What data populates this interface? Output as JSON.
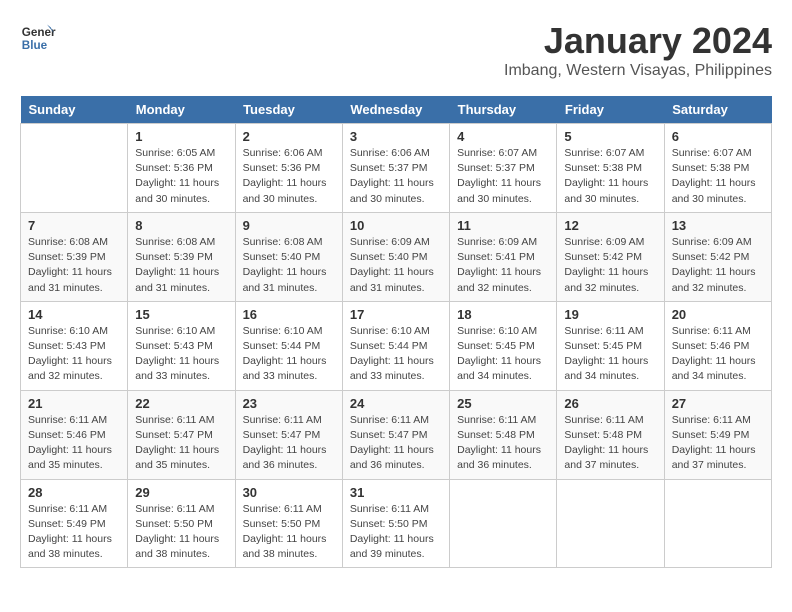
{
  "header": {
    "logo_line1": "General",
    "logo_line2": "Blue",
    "month": "January 2024",
    "location": "Imbang, Western Visayas, Philippines"
  },
  "weekdays": [
    "Sunday",
    "Monday",
    "Tuesday",
    "Wednesday",
    "Thursday",
    "Friday",
    "Saturday"
  ],
  "weeks": [
    [
      {
        "day": "",
        "info": ""
      },
      {
        "day": "1",
        "info": "Sunrise: 6:05 AM\nSunset: 5:36 PM\nDaylight: 11 hours and 30 minutes."
      },
      {
        "day": "2",
        "info": "Sunrise: 6:06 AM\nSunset: 5:36 PM\nDaylight: 11 hours and 30 minutes."
      },
      {
        "day": "3",
        "info": "Sunrise: 6:06 AM\nSunset: 5:37 PM\nDaylight: 11 hours and 30 minutes."
      },
      {
        "day": "4",
        "info": "Sunrise: 6:07 AM\nSunset: 5:37 PM\nDaylight: 11 hours and 30 minutes."
      },
      {
        "day": "5",
        "info": "Sunrise: 6:07 AM\nSunset: 5:38 PM\nDaylight: 11 hours and 30 minutes."
      },
      {
        "day": "6",
        "info": "Sunrise: 6:07 AM\nSunset: 5:38 PM\nDaylight: 11 hours and 30 minutes."
      }
    ],
    [
      {
        "day": "7",
        "info": "Sunrise: 6:08 AM\nSunset: 5:39 PM\nDaylight: 11 hours and 31 minutes."
      },
      {
        "day": "8",
        "info": "Sunrise: 6:08 AM\nSunset: 5:39 PM\nDaylight: 11 hours and 31 minutes."
      },
      {
        "day": "9",
        "info": "Sunrise: 6:08 AM\nSunset: 5:40 PM\nDaylight: 11 hours and 31 minutes."
      },
      {
        "day": "10",
        "info": "Sunrise: 6:09 AM\nSunset: 5:40 PM\nDaylight: 11 hours and 31 minutes."
      },
      {
        "day": "11",
        "info": "Sunrise: 6:09 AM\nSunset: 5:41 PM\nDaylight: 11 hours and 32 minutes."
      },
      {
        "day": "12",
        "info": "Sunrise: 6:09 AM\nSunset: 5:42 PM\nDaylight: 11 hours and 32 minutes."
      },
      {
        "day": "13",
        "info": "Sunrise: 6:09 AM\nSunset: 5:42 PM\nDaylight: 11 hours and 32 minutes."
      }
    ],
    [
      {
        "day": "14",
        "info": "Sunrise: 6:10 AM\nSunset: 5:43 PM\nDaylight: 11 hours and 32 minutes."
      },
      {
        "day": "15",
        "info": "Sunrise: 6:10 AM\nSunset: 5:43 PM\nDaylight: 11 hours and 33 minutes."
      },
      {
        "day": "16",
        "info": "Sunrise: 6:10 AM\nSunset: 5:44 PM\nDaylight: 11 hours and 33 minutes."
      },
      {
        "day": "17",
        "info": "Sunrise: 6:10 AM\nSunset: 5:44 PM\nDaylight: 11 hours and 33 minutes."
      },
      {
        "day": "18",
        "info": "Sunrise: 6:10 AM\nSunset: 5:45 PM\nDaylight: 11 hours and 34 minutes."
      },
      {
        "day": "19",
        "info": "Sunrise: 6:11 AM\nSunset: 5:45 PM\nDaylight: 11 hours and 34 minutes."
      },
      {
        "day": "20",
        "info": "Sunrise: 6:11 AM\nSunset: 5:46 PM\nDaylight: 11 hours and 34 minutes."
      }
    ],
    [
      {
        "day": "21",
        "info": "Sunrise: 6:11 AM\nSunset: 5:46 PM\nDaylight: 11 hours and 35 minutes."
      },
      {
        "day": "22",
        "info": "Sunrise: 6:11 AM\nSunset: 5:47 PM\nDaylight: 11 hours and 35 minutes."
      },
      {
        "day": "23",
        "info": "Sunrise: 6:11 AM\nSunset: 5:47 PM\nDaylight: 11 hours and 36 minutes."
      },
      {
        "day": "24",
        "info": "Sunrise: 6:11 AM\nSunset: 5:47 PM\nDaylight: 11 hours and 36 minutes."
      },
      {
        "day": "25",
        "info": "Sunrise: 6:11 AM\nSunset: 5:48 PM\nDaylight: 11 hours and 36 minutes."
      },
      {
        "day": "26",
        "info": "Sunrise: 6:11 AM\nSunset: 5:48 PM\nDaylight: 11 hours and 37 minutes."
      },
      {
        "day": "27",
        "info": "Sunrise: 6:11 AM\nSunset: 5:49 PM\nDaylight: 11 hours and 37 minutes."
      }
    ],
    [
      {
        "day": "28",
        "info": "Sunrise: 6:11 AM\nSunset: 5:49 PM\nDaylight: 11 hours and 38 minutes."
      },
      {
        "day": "29",
        "info": "Sunrise: 6:11 AM\nSunset: 5:50 PM\nDaylight: 11 hours and 38 minutes."
      },
      {
        "day": "30",
        "info": "Sunrise: 6:11 AM\nSunset: 5:50 PM\nDaylight: 11 hours and 38 minutes."
      },
      {
        "day": "31",
        "info": "Sunrise: 6:11 AM\nSunset: 5:50 PM\nDaylight: 11 hours and 39 minutes."
      },
      {
        "day": "",
        "info": ""
      },
      {
        "day": "",
        "info": ""
      },
      {
        "day": "",
        "info": ""
      }
    ]
  ]
}
